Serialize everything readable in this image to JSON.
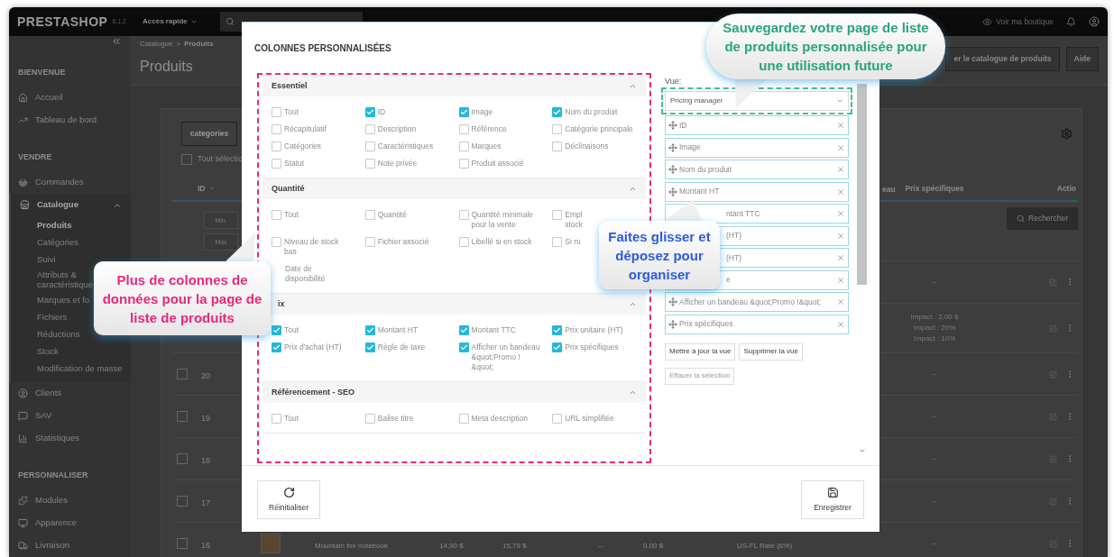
{
  "topbar": {
    "logo": "PRESTASHOP",
    "version": "8.1.2",
    "quick_access": "Accès rapide",
    "view_shop": "Voir ma boutique"
  },
  "sidebar": {
    "sections": [
      {
        "title": "BIENVENUE",
        "items": [
          {
            "label": "Accueil",
            "selected": false
          },
          {
            "label": "Tableau de bord",
            "selected": false
          }
        ]
      },
      {
        "title": "VENDRE",
        "items": [
          {
            "label": "Commandes",
            "selected": false
          },
          {
            "label": "Catalogue",
            "selected": true,
            "expanded": true,
            "children": [
              {
                "label": "Produits",
                "selected": true
              },
              {
                "label": "Catégories",
                "selected": false
              },
              {
                "label": "Suivi",
                "selected": false
              },
              {
                "label": "Attributs & caractéristique",
                "selected": false
              },
              {
                "label": "Marques et fo",
                "selected": false
              },
              {
                "label": "Fichiers",
                "selected": false
              },
              {
                "label": "Réductions",
                "selected": false
              },
              {
                "label": "Stock",
                "selected": false
              },
              {
                "label": "Modification de masse",
                "selected": false
              }
            ]
          },
          {
            "label": "Clients",
            "selected": false
          },
          {
            "label": "SAV",
            "selected": false
          },
          {
            "label": "Statistiques",
            "selected": false
          }
        ]
      },
      {
        "title": "PERSONNALISER",
        "items": [
          {
            "label": "Modules",
            "selected": false
          },
          {
            "label": "Apparence",
            "selected": false
          },
          {
            "label": "Livraison",
            "selected": false
          }
        ]
      }
    ]
  },
  "main": {
    "breadcrumb": [
      "Catalogue",
      "Produits"
    ],
    "breadcrumb_separator": ">",
    "title": "Produits",
    "header_buttons": [
      "er le catalogue de produits",
      "Aide"
    ],
    "category_button": "categories",
    "select_all": {
      "label": "Tout sélectio",
      "checked": false
    },
    "table": {
      "columns": {
        "id": "ID",
        "column_10": "eau",
        "specific_prices": "Prix spécifiques",
        "actions": "Actio"
      },
      "filters": {
        "min": {
          "placeholder": "Min."
        },
        "max": {
          "placeholder": "Max"
        },
        "search_button": "Rechercher"
      },
      "rows": [
        {
          "specific_prices": [
            "--"
          ]
        },
        {
          "specific_prices": [
            "Impact : 2,00 $",
            "Impact : 20%",
            "Impact : 10%"
          ]
        },
        {
          "id": "20",
          "checked": false,
          "specific_prices": [
            "--"
          ]
        },
        {
          "id": "19",
          "checked": false,
          "specific_prices": [
            "--"
          ]
        },
        {
          "id": "18",
          "checked": false,
          "specific_prices": [
            "--"
          ]
        },
        {
          "id": "17",
          "checked": false,
          "specific_prices": [
            "--"
          ]
        },
        {
          "id": "16",
          "checked": false,
          "name": "Mountain fox notebook",
          "price": "14,90 $",
          "price_ttc": "15,79 $",
          "column_7": "--",
          "column_8": "0,00 $",
          "tax_rule": "US-FL Rate (6%)",
          "active": false,
          "specific_prices": [
            "--"
          ]
        }
      ]
    }
  },
  "modal": {
    "title": "COLONNES PERSONNALISÉES",
    "groups": [
      {
        "title": "Essentiel",
        "expanded": true,
        "items": [
          {
            "label": "Tout",
            "checked": false
          },
          {
            "label": "ID",
            "checked": true
          },
          {
            "label": "Image",
            "checked": true
          },
          {
            "label": "Nom du produit",
            "checked": true
          },
          {
            "label": "Récapitulatif",
            "checked": false
          },
          {
            "label": "Description",
            "checked": false
          },
          {
            "label": "Référence",
            "checked": false
          },
          {
            "label": "Catégorie principale",
            "checked": false
          },
          {
            "label": "Catégories",
            "checked": false
          },
          {
            "label": "Caractéristiques",
            "checked": false
          },
          {
            "label": "Marques",
            "checked": false
          },
          {
            "label": "Déclinaisons",
            "checked": false
          },
          {
            "label": "Statut",
            "checked": false
          },
          {
            "label": "Note privée",
            "checked": false
          },
          {
            "label": "Produit associé",
            "checked": false
          }
        ]
      },
      {
        "title": "Quantité",
        "expanded": true,
        "items": [
          {
            "label": "Tout",
            "checked": false
          },
          {
            "label": "Quantité",
            "checked": false
          },
          {
            "label": "Quantité minimale pour la vente",
            "checked": false
          },
          {
            "label": "Empl\nstock",
            "checked": false
          },
          {
            "label": "Niveau de stock bas",
            "checked": false
          },
          {
            "label": "Fichier associé",
            "checked": false
          },
          {
            "label": "Libellé si en stock",
            "checked": false
          },
          {
            "label": "Si ru",
            "checked": false
          },
          {
            "label": "Date de disponibilité",
            "covered": true
          }
        ]
      },
      {
        "title": "ix",
        "covered": true,
        "expanded": true,
        "items": [
          {
            "label": "Tout",
            "checked": true
          },
          {
            "label": "Montant HT",
            "checked": true
          },
          {
            "label": "Montant TTC",
            "checked": true
          },
          {
            "label": "Prix unitaire (HT)",
            "checked": true
          },
          {
            "label": "Prix d'achat (HT)",
            "checked": true
          },
          {
            "label": "Règle de taxe",
            "checked": true
          },
          {
            "label": "Afficher un bandeau &quot;Promo ! &quot;",
            "checked": true
          },
          {
            "label": "Prix spécifiques",
            "checked": true
          }
        ]
      },
      {
        "title": "Référencement - SEO",
        "expanded": true,
        "items": [
          {
            "label": "Tout",
            "checked": false
          },
          {
            "label": "Balise titre",
            "checked": false
          },
          {
            "label": "Meta description",
            "checked": false
          },
          {
            "label": "URL simplifiée",
            "checked": false
          }
        ]
      }
    ],
    "view": {
      "label": "Vue:",
      "value": "Pricing manager",
      "columns": [
        {
          "label": "ID"
        },
        {
          "label": "Image"
        },
        {
          "label": "Nom du produit"
        },
        {
          "label": "Montant HT"
        },
        {
          "label": "ntant TTC",
          "covered": true
        },
        {
          "label": "(HT)",
          "covered": true
        },
        {
          "label": "(HT)",
          "covered": true
        },
        {
          "label": "e",
          "covered": true
        },
        {
          "label": "Afficher un bandeau &quot;Promo !&quot;"
        },
        {
          "label": "Prix spécifiques"
        }
      ],
      "buttons": [
        {
          "label": "Mettre à jour la vue",
          "disabled": false
        },
        {
          "label": "Supprimer la vue",
          "disabled": false
        },
        {
          "label": "Effacer la sélection",
          "disabled": true
        }
      ]
    },
    "footer_buttons": [
      "Réinitialiser",
      "Enregistrer"
    ]
  },
  "callouts": [
    {
      "text": "Sauvegardez votre page de liste de produits personnalisée pour une utilisation future",
      "color": "#2aa57a"
    },
    {
      "text": "Faites glisser et déposez pour organiser",
      "color": "#2c5be0"
    },
    {
      "text": "Plus de colonnes de données pour la page de liste de produits",
      "color": "#e9287c"
    }
  ]
}
